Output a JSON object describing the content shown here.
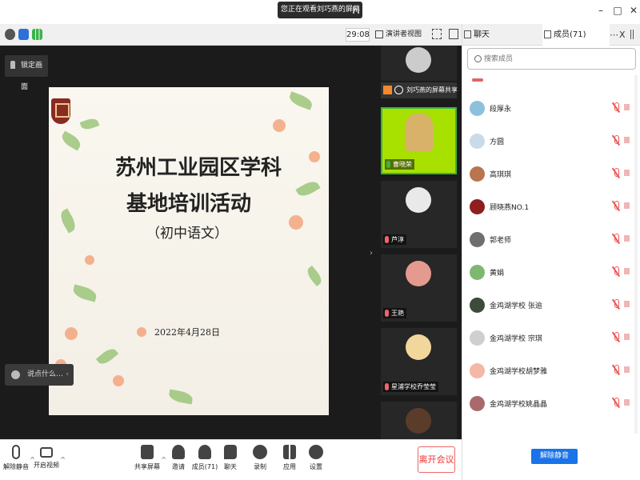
{
  "titlebar": {
    "viewing": "您正在观看刘巧燕的屏幕",
    "minimize": "–",
    "maximize": "□",
    "close": "✕"
  },
  "toolbar": {
    "timer": "29:08",
    "view_mode": "演讲者视图",
    "view_caret": "▾"
  },
  "stage": {
    "lock_label": "锁定画面",
    "chat_hint": "说点什么…",
    "chat_arrow": "‹",
    "side_arrow": "›",
    "slide": {
      "title_line1": "苏州工业园区学科",
      "title_line2": "基地培训活动",
      "title_line3": "（初中语文）",
      "date": "2022年4月28日"
    }
  },
  "videos": {
    "share_label": "刘巧燕的屏幕共享",
    "tiles": [
      {
        "name": "曹晓荣",
        "active": true,
        "color": "#d9b26a"
      },
      {
        "name": "芦淳",
        "active": false,
        "color": "#e9e9e9"
      },
      {
        "name": "王艳",
        "active": false,
        "color": "#e49a8e"
      },
      {
        "name": "星浦学校乔莹莹",
        "active": false,
        "color": "#f2d79c"
      },
      {
        "name": "",
        "active": false,
        "color": "#5b3b2a"
      }
    ]
  },
  "bottombar": {
    "unmute": "解除静音",
    "start_video": "开启视频",
    "share_screen": "共享屏幕",
    "invite": "邀请",
    "members": "成员(71)",
    "chat": "聊天",
    "record": "录制",
    "apps": "应用",
    "settings": "设置",
    "leave": "离开会议",
    "caret": "^"
  },
  "rpanel": {
    "tab_chat": "聊天",
    "tab_members": "成员(71)",
    "more": "⋯",
    "close": "X",
    "search_placeholder": "搜索成员",
    "unmute_all": "解除静音",
    "members": [
      {
        "name": "段厚永",
        "color": "#8cc1dc"
      },
      {
        "name": "方圆",
        "color": "#c9dbe8"
      },
      {
        "name": "高琪琪",
        "color": "#b9754e"
      },
      {
        "name": "顾晓燕NO.1",
        "color": "#8e1f1f"
      },
      {
        "name": "郭老师",
        "color": "#6f6f6f"
      },
      {
        "name": "黄娟",
        "color": "#7eb870"
      },
      {
        "name": "金鸡湖学校 张逾",
        "color": "#3d4b3a"
      },
      {
        "name": "金鸡湖学校 宗琪",
        "color": "#cfcfcf"
      },
      {
        "name": "金鸡湖学校胡梦雅",
        "color": "#f3b8a6"
      },
      {
        "name": "金鸡湖学校姚晶晶",
        "color": "#a86a6a"
      }
    ]
  }
}
